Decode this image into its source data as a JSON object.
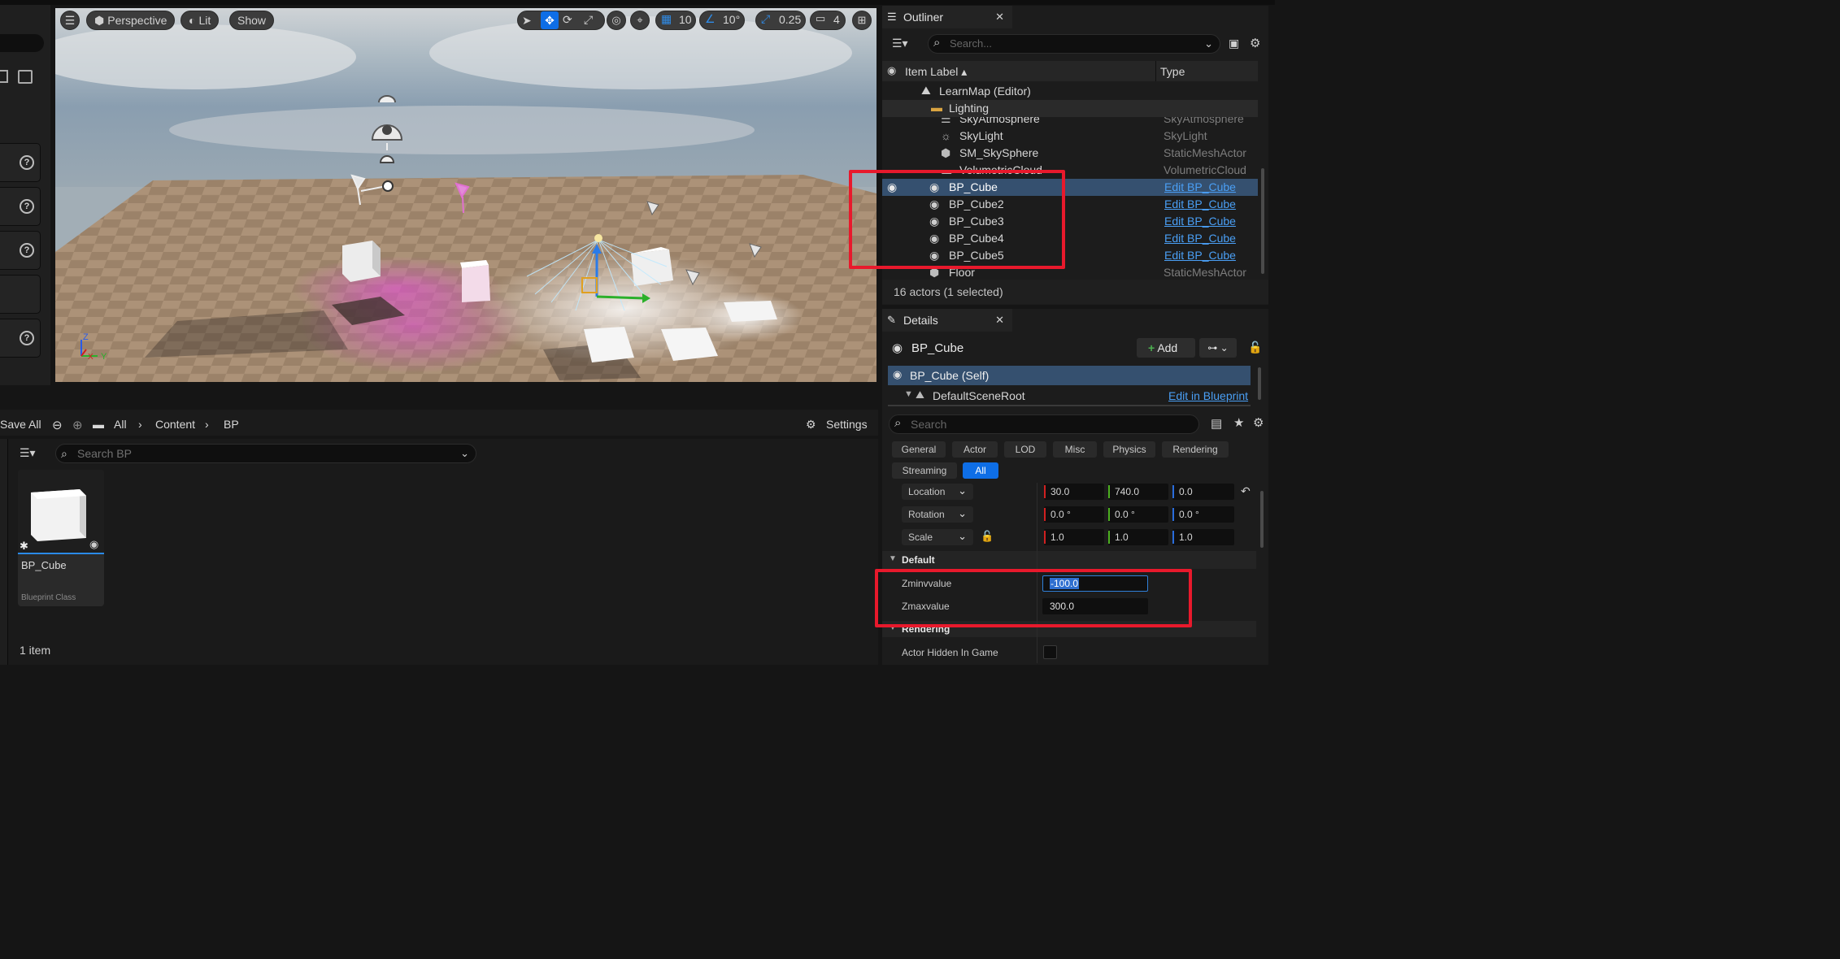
{
  "viewport": {
    "perspective_label": "Perspective",
    "lit_label": "Lit",
    "show_label": "Show",
    "grid_snap": "10",
    "angle_snap": "10°",
    "scale_snap": "0.25",
    "camera_speed": "4"
  },
  "content_browser": {
    "save_all": "Save All",
    "breadcrumb": [
      "All",
      "Content",
      "BP"
    ],
    "settings_label": "Settings",
    "search_placeholder": "Search BP",
    "asset": {
      "name": "BP_Cube",
      "type": "Blueprint Class"
    },
    "item_count": "1 item"
  },
  "outliner": {
    "title": "Outliner",
    "search_placeholder": "Search...",
    "col_label": "Item Label",
    "col_type": "Type",
    "map_name": "LearnMap (Editor)",
    "folder_name": "Lighting",
    "rows": [
      {
        "label": "SkyAtmosphere",
        "type": "SkyAtmosphere"
      },
      {
        "label": "SkyLight",
        "type": "SkyLight"
      },
      {
        "label": "SM_SkySphere",
        "type": "StaticMeshActor"
      },
      {
        "label": "VolumetricCloud",
        "type": "VolumetricCloud"
      },
      {
        "label": "BP_Cube",
        "type": "Edit BP_Cube"
      },
      {
        "label": "BP_Cube2",
        "type": "Edit BP_Cube"
      },
      {
        "label": "BP_Cube3",
        "type": "Edit BP_Cube"
      },
      {
        "label": "BP_Cube4",
        "type": "Edit BP_Cube"
      },
      {
        "label": "BP_Cube5",
        "type": "Edit BP_Cube"
      },
      {
        "label": "Floor",
        "type": "StaticMeshActor"
      }
    ],
    "status": "16 actors (1 selected)"
  },
  "details": {
    "title": "Details",
    "actor_name": "BP_Cube",
    "add_label": "Add",
    "self_label": "BP_Cube (Self)",
    "root_label": "DefaultSceneRoot",
    "edit_blueprint": "Edit in Blueprint",
    "search_placeholder": "Search",
    "tabs": [
      "General",
      "Actor",
      "LOD",
      "Misc",
      "Physics",
      "Rendering",
      "Streaming",
      "All"
    ],
    "location_label": "Location",
    "rotation_label": "Rotation",
    "scale_label": "Scale",
    "location": [
      "30.0",
      "740.0",
      "0.0"
    ],
    "rotation": [
      "0.0 °",
      "0.0 °",
      "0.0 °"
    ],
    "scale": [
      "1.0",
      "1.0",
      "1.0"
    ],
    "default_section": "Default",
    "zmin_label": "Zminvvalue",
    "zmin_value": "-100.0",
    "zmax_label": "Zmaxvalue",
    "zmax_value": "300.0",
    "rendering_section": "Rendering",
    "hidden_label": "Actor Hidden In Game"
  },
  "colors": {
    "accent": "#0e6ee6",
    "link": "#4a9ff5",
    "highlight": "#e8192c",
    "selected_row": "#35506f"
  }
}
